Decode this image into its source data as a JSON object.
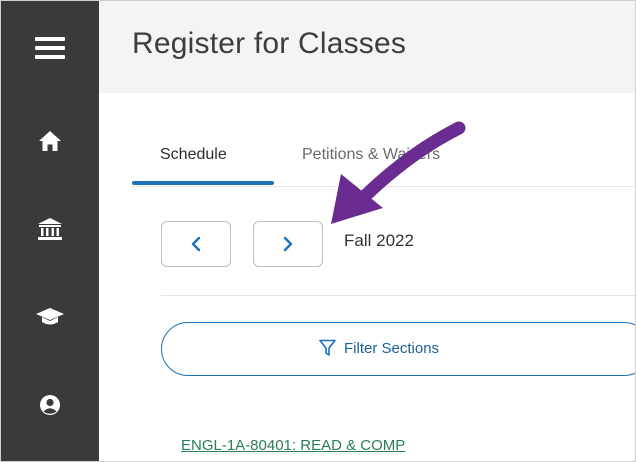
{
  "header": {
    "title": "Register for Classes"
  },
  "sidebar": {
    "items": [
      {
        "icon": "hamburger-menu-icon"
      },
      {
        "icon": "home-icon"
      },
      {
        "icon": "institution-icon"
      },
      {
        "icon": "graduation-cap-icon"
      },
      {
        "icon": "user-circle-icon"
      }
    ],
    "background": "#3a3a3a"
  },
  "tabs": [
    {
      "label": "Schedule",
      "active": true
    },
    {
      "label": "Petitions & Waivers",
      "active": false
    }
  ],
  "term": {
    "prev_icon": "chevron-left-icon",
    "next_icon": "chevron-right-icon",
    "label": "Fall 2022"
  },
  "filter": {
    "label": "Filter Sections",
    "icon": "filter-icon"
  },
  "course": {
    "link_text": "ENGL-1A-80401: READ & COMP"
  },
  "annotation": {
    "icon": "arrow-icon",
    "color": "#6b2c91"
  },
  "colors": {
    "accent": "#1c72b8",
    "link": "#2a7d54"
  }
}
